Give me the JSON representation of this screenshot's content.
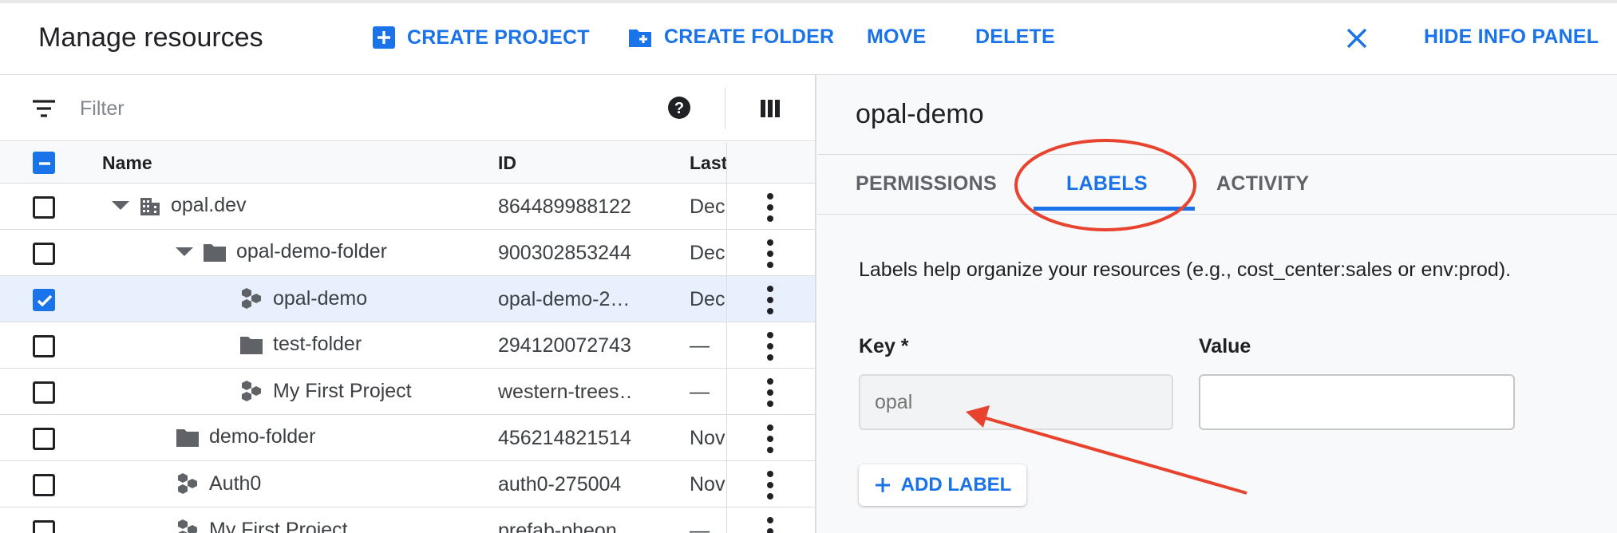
{
  "header": {
    "title": "Manage resources",
    "create_project": "CREATE PROJECT",
    "create_folder": "CREATE FOLDER",
    "move": "MOVE",
    "delete": "DELETE",
    "hide_info_panel": "HIDE INFO PANEL"
  },
  "filter": {
    "placeholder": "Filter"
  },
  "table": {
    "columns": [
      "Name",
      "ID",
      "Last"
    ],
    "rows": [
      {
        "name": "opal.dev",
        "id": "864489988122",
        "last": "Dec",
        "type": "organization",
        "checked": false
      },
      {
        "name": "opal-demo-folder",
        "id": "900302853244",
        "last": "Dec",
        "type": "folder",
        "checked": false
      },
      {
        "name": "opal-demo",
        "id": "opal-demo-2…",
        "last": "Dec",
        "type": "project",
        "checked": true
      },
      {
        "name": "test-folder",
        "id": "294120072743",
        "last": "—",
        "type": "folder",
        "checked": false
      },
      {
        "name": "My First Project",
        "id": "western-trees…",
        "last": "—",
        "type": "project",
        "checked": false
      },
      {
        "name": "demo-folder",
        "id": "456214821514",
        "last": "Nov",
        "type": "folder",
        "checked": false
      },
      {
        "name": "Auth0",
        "id": "auth0-275004",
        "last": "Nov",
        "type": "project",
        "checked": false
      },
      {
        "name": "My First Project",
        "id": "prefab-pheon…",
        "last": "—",
        "type": "project",
        "checked": false
      }
    ]
  },
  "info_panel": {
    "title": "opal-demo",
    "tabs": [
      "PERMISSIONS",
      "LABELS",
      "ACTIVITY"
    ],
    "active_tab": "LABELS",
    "description": "Labels help organize your resources (e.g., cost_center:sales or env:prod).",
    "key_label": "Key *",
    "value_label": "Value",
    "key_placeholder": "opal",
    "value_placeholder": "",
    "add_label": "ADD LABEL"
  },
  "colors": {
    "accent": "#1a73e8",
    "selected_row": "#e8f0fe",
    "annotation": "#e8432e"
  }
}
